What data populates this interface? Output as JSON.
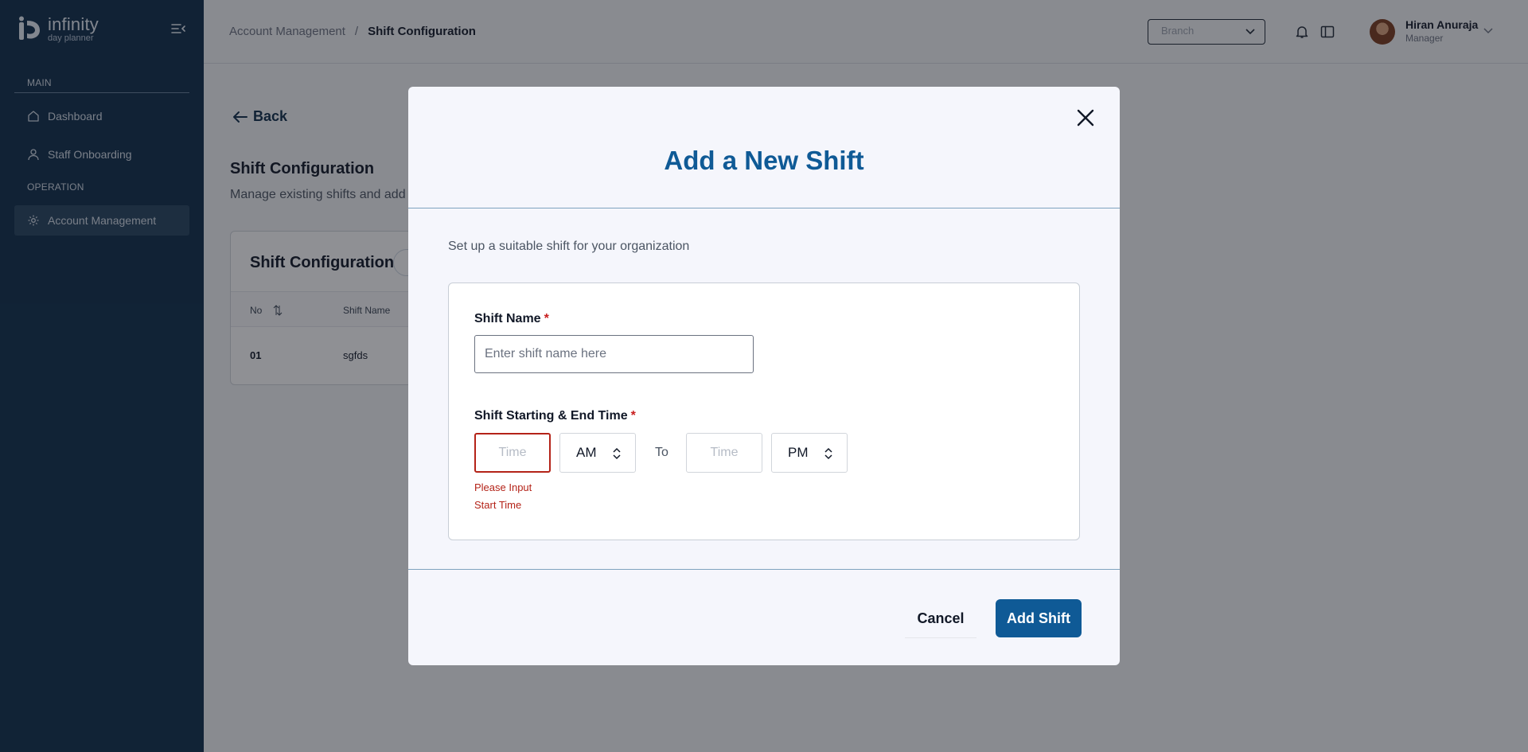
{
  "brand": {
    "name": "infinity",
    "tagline": "day planner"
  },
  "sidebar": {
    "sections": [
      {
        "label": "MAIN",
        "items": [
          {
            "label": "Dashboard",
            "icon": "home-icon"
          },
          {
            "label": "Staff Onboarding",
            "icon": "user-icon"
          }
        ]
      },
      {
        "label": "OPERATION",
        "items": [
          {
            "label": "Account Management",
            "icon": "gear-icon",
            "active": true
          }
        ]
      }
    ]
  },
  "header": {
    "breadcrumb": {
      "parent": "Account Management",
      "separator": "/",
      "current": "Shift Configuration"
    },
    "branch_placeholder": "Branch",
    "user": {
      "name": "Hiran Anuraja",
      "role": "Manager"
    }
  },
  "page": {
    "back_label": "Back",
    "title": "Shift Configuration",
    "subtitle": "Manage existing shifts and add",
    "card": {
      "title": "Shift Configuration",
      "columns": [
        "No",
        "Shift Name"
      ],
      "rows": [
        {
          "no": "01",
          "name": "sgfds"
        }
      ]
    }
  },
  "modal": {
    "title": "Add a New Shift",
    "subtitle": "Set up a suitable shift for your organization",
    "shift_name": {
      "label": "Shift Name",
      "required_mark": "*",
      "placeholder": "Enter shift name here",
      "value": ""
    },
    "shift_time": {
      "label": "Shift Starting & End Time",
      "required_mark": "*",
      "start_placeholder": "Time",
      "start_period": "AM",
      "to_label": "To",
      "end_placeholder": "Time",
      "end_period": "PM",
      "error": "Please Input Start Time"
    },
    "cancel_label": "Cancel",
    "submit_label": "Add Shift"
  },
  "colors": {
    "sidebar_bg": "#0f2d4a",
    "primary": "#0f5a96",
    "error": "#b42318"
  }
}
